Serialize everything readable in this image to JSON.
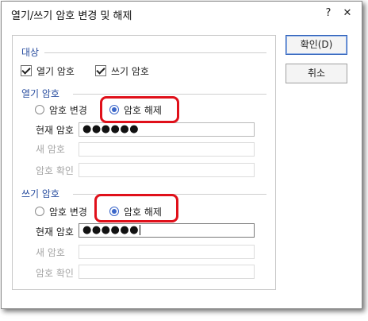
{
  "window": {
    "title": "열기/쓰기 암호 변경 및 해제",
    "help_label": "?",
    "close_label": "✕"
  },
  "target": {
    "section_label": "대상",
    "open_checkbox": {
      "label": "열기 암호",
      "checked": true
    },
    "write_checkbox": {
      "label": "쓰기 암호",
      "checked": true
    }
  },
  "open_password": {
    "section_label": "열기 암호",
    "change_radio": {
      "label": "암호 변경",
      "checked": false
    },
    "remove_radio": {
      "label": "암호 해제",
      "checked": true
    },
    "current_label": "현재 암호",
    "current_value": "●●●●●●",
    "new_label": "새 암호",
    "confirm_label": "암호 확인"
  },
  "write_password": {
    "section_label": "쓰기 암호",
    "change_radio": {
      "label": "암호 변경",
      "checked": false
    },
    "remove_radio": {
      "label": "암호 해제",
      "checked": true
    },
    "current_label": "현재 암호",
    "current_value": "●●●●●●",
    "new_label": "새 암호",
    "confirm_label": "암호 확인"
  },
  "buttons": {
    "ok_label": "확인(D)",
    "cancel_label": "취소"
  },
  "colors": {
    "section_heading": "#2b4fa0",
    "highlight": "#e0101a",
    "radio_selected": "#3a66c9"
  }
}
